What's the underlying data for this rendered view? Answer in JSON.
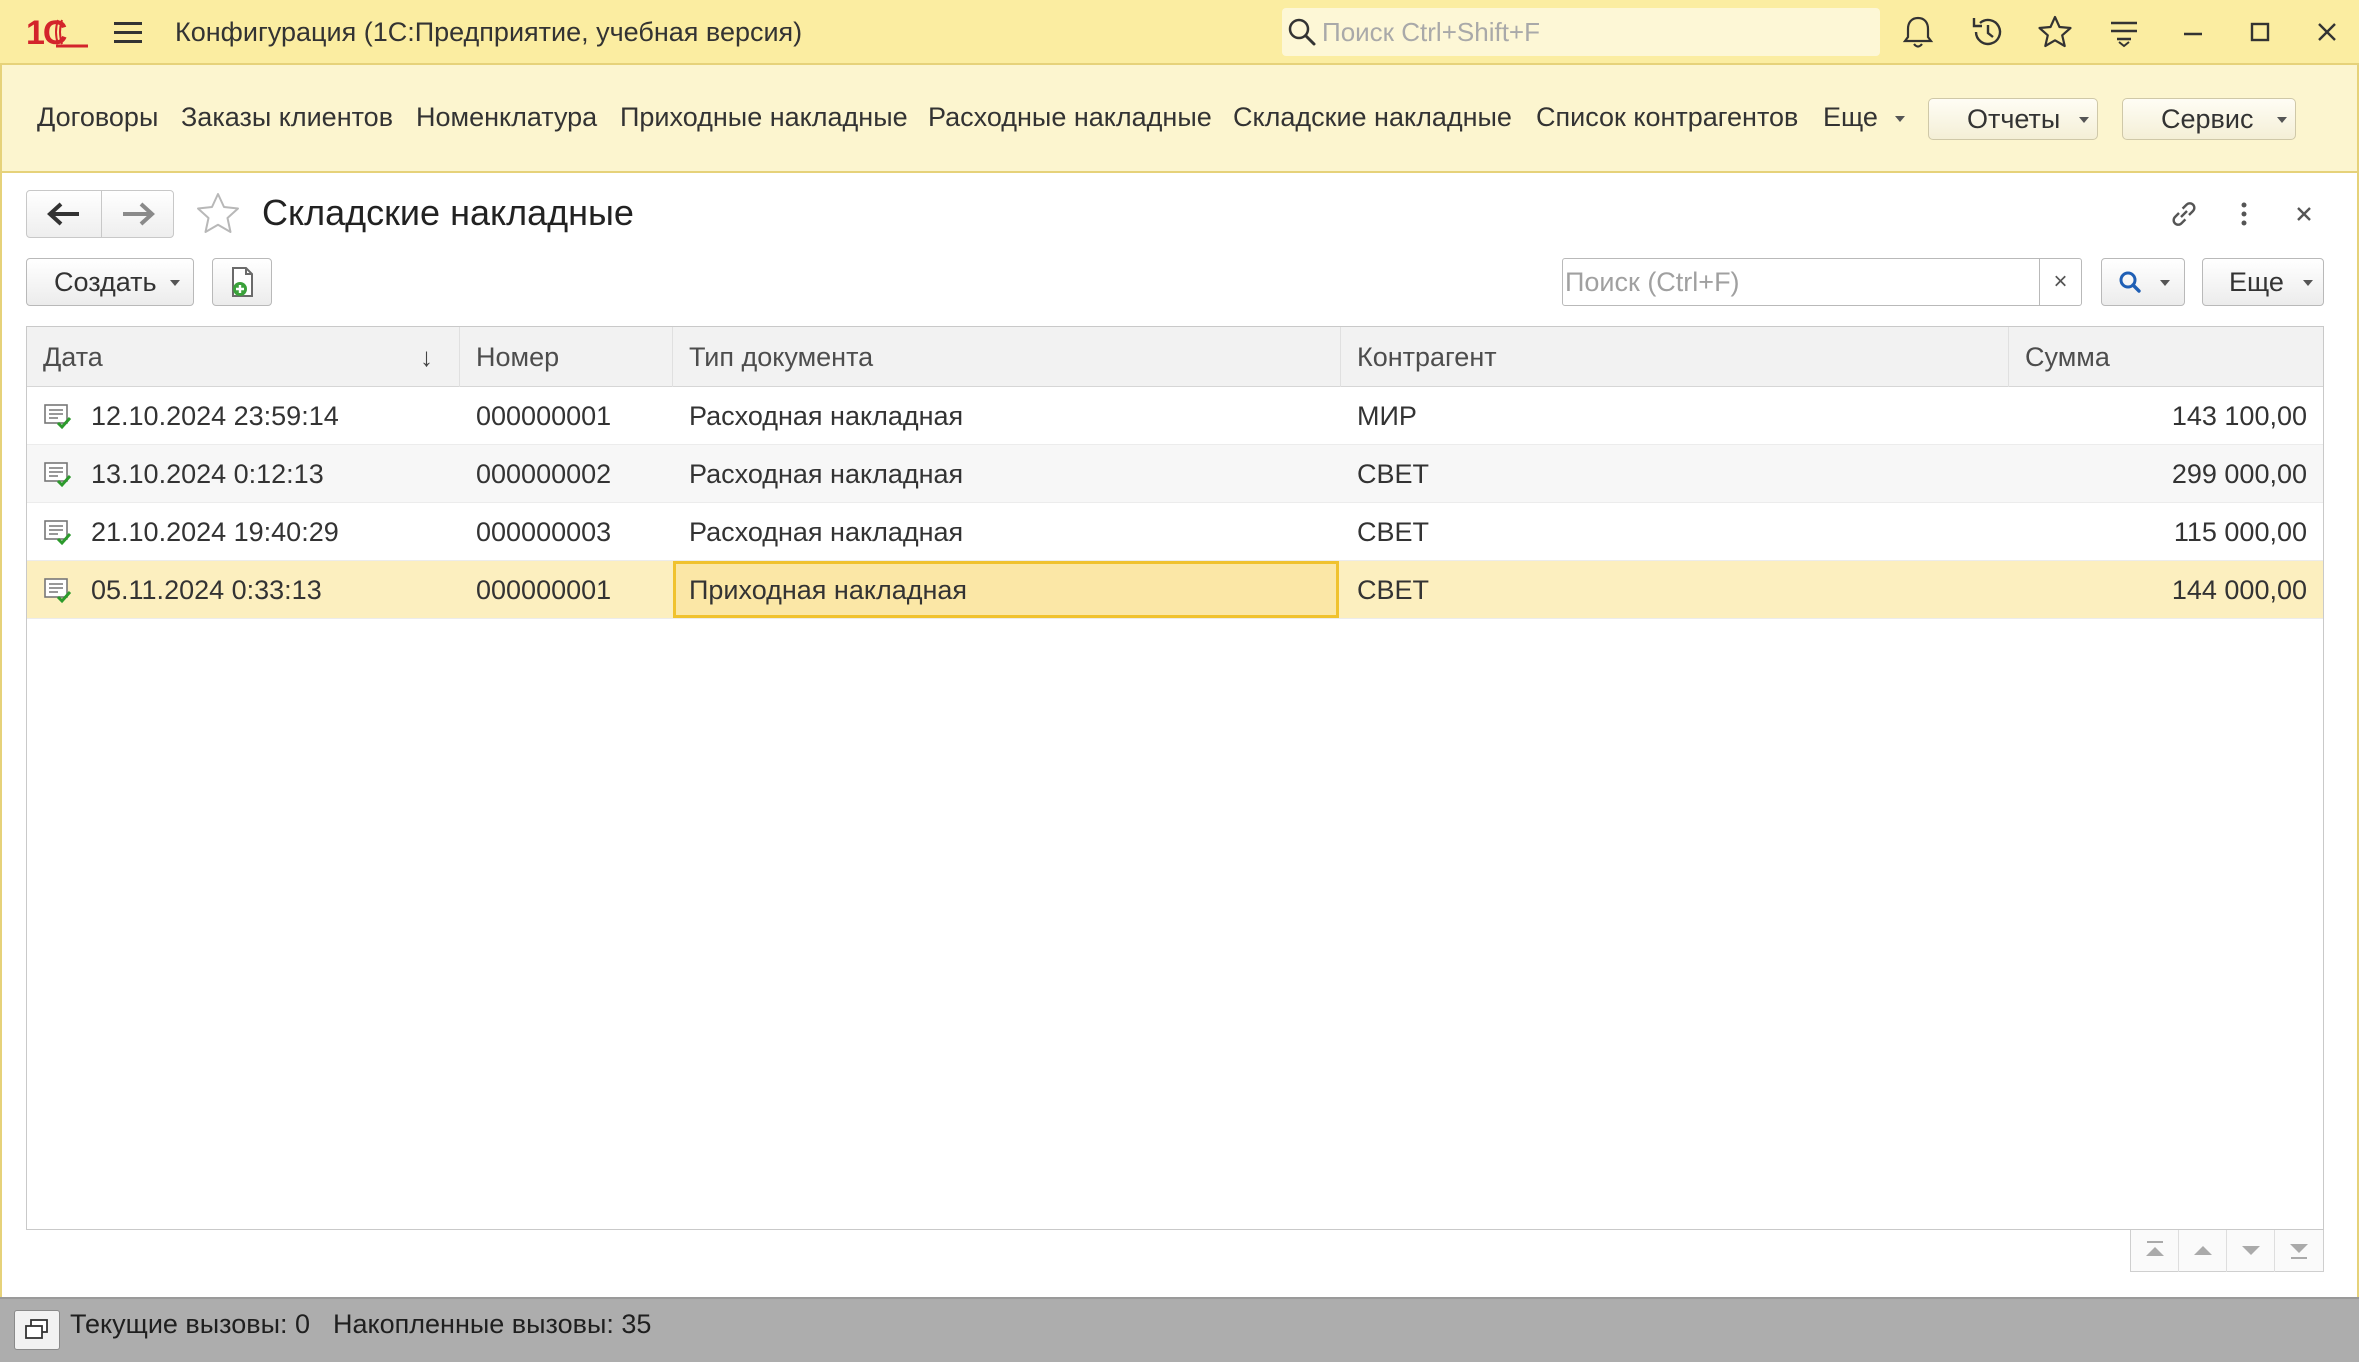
{
  "titlebar": {
    "logo_text": "1С",
    "app_title": "Конфигурация  (1С:Предприятие, учебная версия)",
    "search_placeholder": "Поиск Ctrl+Shift+F"
  },
  "sections": {
    "links": [
      "Договоры",
      "Заказы клиентов",
      "Номенклатура",
      "Приходные накладные",
      "Расходные накладные",
      "Складские накладные",
      "Список контрагентов"
    ],
    "more_label": "Еще",
    "reports_label": "Отчеты",
    "service_label": "Сервис"
  },
  "form": {
    "title": "Складские накладные"
  },
  "commandbar": {
    "create_label": "Создать",
    "search_placeholder": "Поиск (Ctrl+F)",
    "clear_label": "×",
    "more_label": "Еще"
  },
  "table": {
    "columns": [
      "Дата",
      "Номер",
      "Тип документа",
      "Контрагент",
      "Сумма"
    ],
    "sort_indicator": "↓",
    "rows": [
      {
        "date": "12.10.2024 23:59:14",
        "number": "000000001",
        "type": "Расходная накладная",
        "counterparty": "МИР",
        "sum": "143 100,00"
      },
      {
        "date": "13.10.2024 0:12:13",
        "number": "000000002",
        "type": "Расходная накладная",
        "counterparty": "СВЕТ",
        "sum": "299 000,00"
      },
      {
        "date": "21.10.2024 19:40:29",
        "number": "000000003",
        "type": "Расходная накладная",
        "counterparty": "СВЕТ",
        "sum": "115 000,00"
      },
      {
        "date": "05.11.2024 0:33:13",
        "number": "000000001",
        "type": "Приходная накладная",
        "counterparty": "СВЕТ",
        "sum": "144 000,00"
      }
    ],
    "selected_row_index": 3,
    "focused_column": "type"
  },
  "statusbar": {
    "current_calls": "Текущие вызовы: 0",
    "accumulated_calls": "Накопленные вызовы: 35"
  },
  "colors": {
    "titlebar_bg": "#fbeda1",
    "sections_bg": "#fcf5cf",
    "selected_row": "#fcefbf",
    "focus_border": "#f0c22e",
    "logo_red": "#d3242b",
    "statusbar_bg": "#adadad"
  }
}
